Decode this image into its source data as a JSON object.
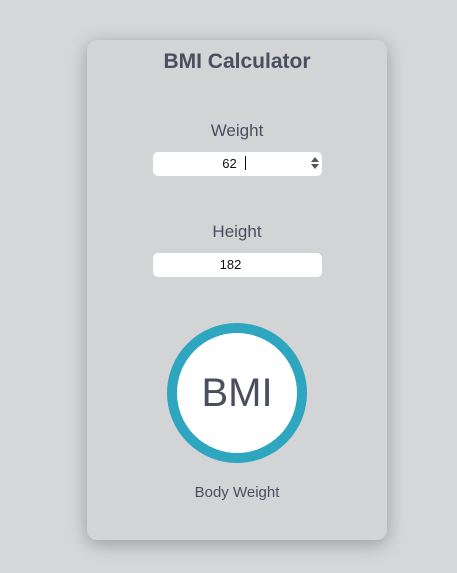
{
  "title": "BMI Calculator",
  "weight": {
    "label": "Weight",
    "value": "62"
  },
  "height": {
    "label": "Height",
    "value": "182"
  },
  "result": {
    "circle_text": "BMI",
    "category": "Body Weight"
  },
  "colors": {
    "background": "#d6d7d9",
    "card": "#d3d4d6",
    "text": "#4a4e5e",
    "ring": "#2ea6c0"
  },
  "icons": {
    "stepper": "spinner-arrows-icon"
  }
}
